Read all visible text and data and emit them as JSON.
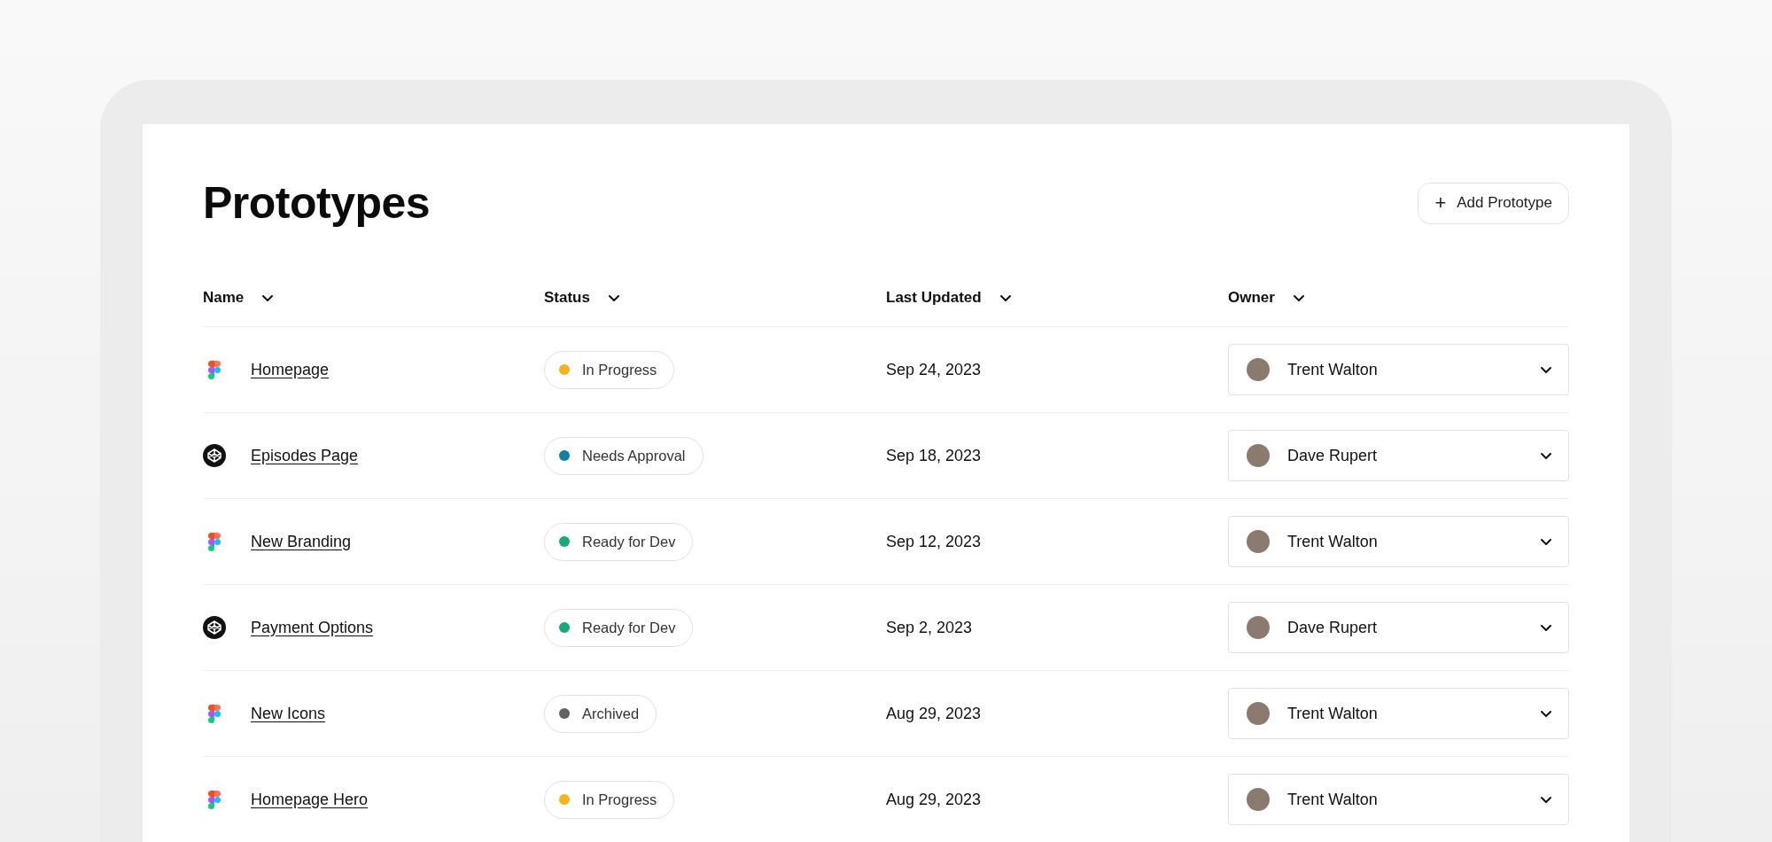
{
  "title": "Prototypes",
  "add_button": {
    "label": "Add Prototype",
    "icon": "+"
  },
  "table": {
    "columns": [
      "Name",
      "Status",
      "Last Updated",
      "Owner"
    ],
    "rows": [
      {
        "kind": "figma",
        "name": "Homepage",
        "status": {
          "label": "In Progress",
          "color": "#f5b21f"
        },
        "updated": "Sep 24, 2023",
        "owner": "Trent Walton"
      },
      {
        "kind": "codepen",
        "name": "Episodes Page",
        "status": {
          "label": "Needs Approval",
          "color": "#10819e"
        },
        "updated": "Sep 18, 2023",
        "owner": "Dave Rupert"
      },
      {
        "kind": "figma",
        "name": "New Branding",
        "status": {
          "label": "Ready for Dev",
          "color": "#1aa87a"
        },
        "updated": "Sep 12, 2023",
        "owner": "Trent Walton"
      },
      {
        "kind": "codepen",
        "name": "Payment Options",
        "status": {
          "label": "Ready for Dev",
          "color": "#1aa87a"
        },
        "updated": "Sep 2, 2023",
        "owner": "Dave Rupert"
      },
      {
        "kind": "figma",
        "name": "New Icons",
        "status": {
          "label": "Archived",
          "color": "#636363"
        },
        "updated": "Aug 29, 2023",
        "owner": "Trent Walton"
      },
      {
        "kind": "figma",
        "name": "Homepage Hero",
        "status": {
          "label": "In Progress",
          "color": "#f5b21f"
        },
        "updated": "Aug 29, 2023",
        "owner": "Trent Walton"
      }
    ]
  }
}
